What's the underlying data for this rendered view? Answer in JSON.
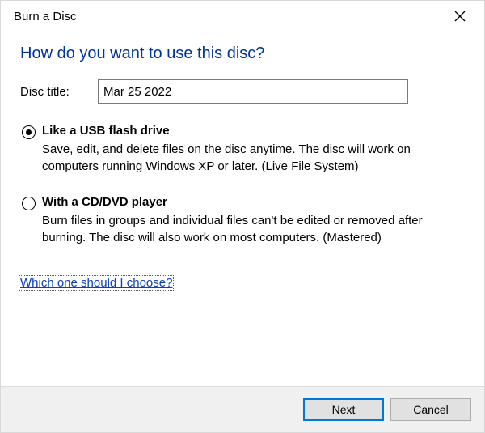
{
  "window": {
    "title": "Burn a Disc"
  },
  "heading": "How do you want to use this disc?",
  "disc_title": {
    "label": "Disc title:",
    "value": "Mar 25 2022"
  },
  "options": [
    {
      "title": "Like a USB flash drive",
      "description": "Save, edit, and delete files on the disc anytime. The disc will work on computers running Windows XP or later. (Live File System)",
      "selected": true
    },
    {
      "title": "With a CD/DVD player",
      "description": "Burn files in groups and individual files can't be edited or removed after burning. The disc will also work on most computers. (Mastered)",
      "selected": false
    }
  ],
  "help_link": "Which one should I choose?",
  "buttons": {
    "next": "Next",
    "cancel": "Cancel"
  }
}
